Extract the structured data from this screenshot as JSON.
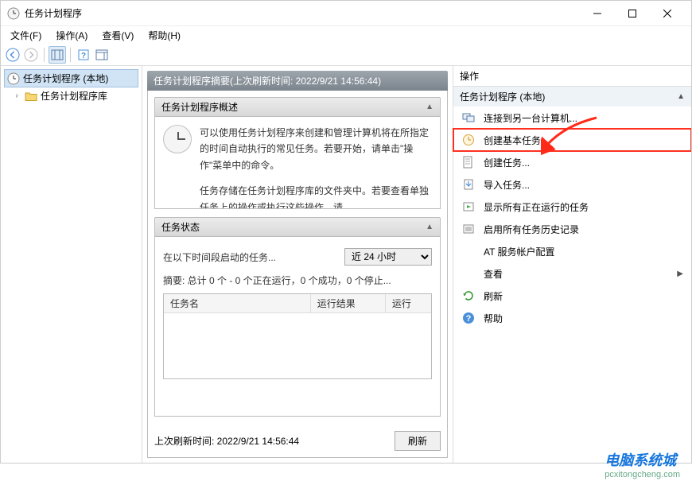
{
  "window": {
    "title": "任务计划程序"
  },
  "menu": {
    "file": "文件(F)",
    "action": "操作(A)",
    "view": "查看(V)",
    "help": "帮助(H)"
  },
  "tree": {
    "root": "任务计划程序 (本地)",
    "library": "任务计划程序库"
  },
  "summary": {
    "header_prefix": "任务计划程序摘要(上次刷新时间: ",
    "header_time": "2022/9/21 14:56:44",
    "header_suffix": ")",
    "overview_title": "任务计划程序概述",
    "overview_p1": "可以使用任务计划程序来创建和管理计算机将在所指定的时间自动执行的常见任务。若要开始，请单击\"操作\"菜单中的命令。",
    "overview_p2": "任务存储在任务计划程序库的文件夹中。若要查看单独任务上的操作或执行这些操作，请",
    "status_title": "任务状态",
    "status_label": "在以下时间段启动的任务...",
    "status_select": "近 24 小时",
    "status_summary": "摘要: 总计 0 个 - 0 个正在运行，0 个成功，0 个停止...",
    "col_name": "任务名",
    "col_result": "运行结果",
    "col_run": "运行",
    "footer_prefix": "上次刷新时间: ",
    "footer_time": "2022/9/21 14:56:44",
    "refresh_btn": "刷新"
  },
  "actions": {
    "header": "操作",
    "subheader": "任务计划程序 (本地)",
    "items": [
      {
        "label": "连接到另一台计算机...",
        "icon": "connect"
      },
      {
        "label": "创建基本任务...",
        "icon": "basic-task",
        "highlight": true
      },
      {
        "label": "创建任务...",
        "icon": "create-task"
      },
      {
        "label": "导入任务...",
        "icon": "import"
      },
      {
        "label": "显示所有正在运行的任务",
        "icon": "running"
      },
      {
        "label": "启用所有任务历史记录",
        "icon": "history"
      },
      {
        "label": "AT 服务帐户配置",
        "icon": "none"
      },
      {
        "label": "查看",
        "icon": "none",
        "submenu": true
      },
      {
        "label": "刷新",
        "icon": "refresh"
      },
      {
        "label": "帮助",
        "icon": "help"
      }
    ]
  },
  "watermark": {
    "main": "电脑系统城",
    "sub": "pcxitongcheng.com"
  }
}
